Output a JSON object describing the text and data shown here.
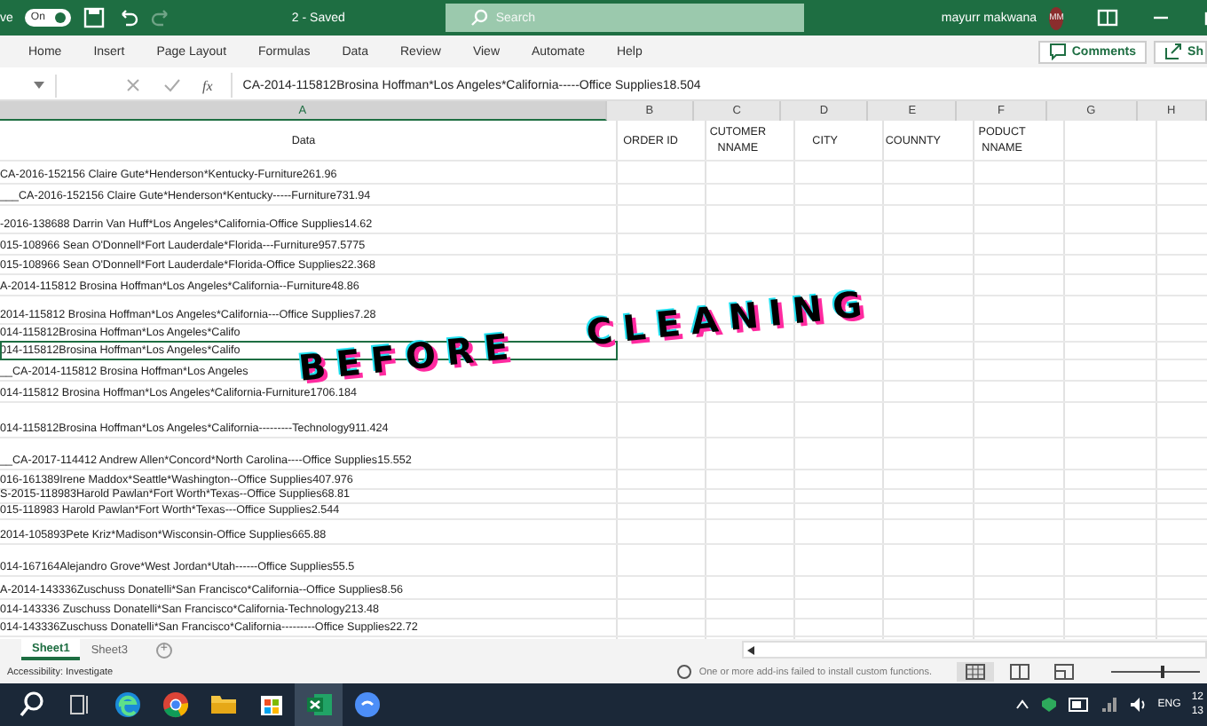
{
  "title_bar": {
    "autosave_label": "ve",
    "autosave_toggle": {
      "label": "On",
      "on": true
    },
    "doc_status": "2 - Saved",
    "search": {
      "placeholder": "Search"
    },
    "user_name": "mayurr makwana",
    "user_initials": "MM"
  },
  "ribbon_tabs": [
    {
      "label": "Home",
      "selected": false
    },
    {
      "label": "Insert",
      "selected": false
    },
    {
      "label": "Page Layout",
      "selected": false
    },
    {
      "label": "Formulas",
      "selected": false
    },
    {
      "label": "Data",
      "selected": false
    },
    {
      "label": "Review",
      "selected": false
    },
    {
      "label": "View",
      "selected": false
    },
    {
      "label": "Automate",
      "selected": false
    },
    {
      "label": "Help",
      "selected": false
    }
  ],
  "ribbon_buttons": {
    "comments": "Comments",
    "share": "Sh"
  },
  "formula_bar": {
    "fx": "fx",
    "value": "CA-2014-115812Brosina Hoffman*Los Angeles*California-----Office Supplies18.504"
  },
  "columns": [
    {
      "label": "A",
      "selected": true
    },
    {
      "label": "B",
      "selected": false
    },
    {
      "label": "C",
      "selected": false
    },
    {
      "label": "D",
      "selected": false
    },
    {
      "label": "E",
      "selected": false
    },
    {
      "label": "F",
      "selected": false
    },
    {
      "label": "G",
      "selected": false
    },
    {
      "label": "H",
      "selected": false
    }
  ],
  "header_row": [
    "Data",
    "ORDER ID",
    "CUTOMER NNAME",
    "CITY",
    "COUNNTY",
    "PODUCT NNAME"
  ],
  "rows": [
    {
      "text": "CA-2016-152156 Claire Gute*Henderson*Kentucky-Furniture261.96",
      "selected": false
    },
    {
      "text": "___CA-2016-152156 Claire Gute*Henderson*Kentucky-----Furniture731.94",
      "selected": false
    },
    {
      "text": "-2016-138688 Darrin Van Huff*Los Angeles*California-Office Supplies14.62",
      "selected": false
    },
    {
      "text": "015-108966 Sean O'Donnell*Fort Lauderdale*Florida---Furniture957.5775",
      "selected": false
    },
    {
      "text": "015-108966 Sean O'Donnell*Fort Lauderdale*Florida-Office Supplies22.368",
      "selected": false
    },
    {
      "text": "A-2014-115812 Brosina Hoffman*Los Angeles*California--Furniture48.86",
      "selected": false
    },
    {
      "text": "2014-115812 Brosina Hoffman*Los Angeles*California---Office Supplies7.28",
      "selected": false
    },
    {
      "text": "014-115812Brosina Hoffman*Los Angeles*Califo",
      "selected": false
    },
    {
      "text": "014-115812Brosina Hoffman*Los Angeles*Califo",
      "selected": true
    },
    {
      "text": "__CA-2014-115812 Brosina Hoffman*Los Angeles",
      "selected": false
    },
    {
      "text": "014-115812 Brosina Hoffman*Los Angeles*California-Furniture1706.184",
      "selected": false
    },
    {
      "text": "014-115812Brosina Hoffman*Los Angeles*California---------Technology911.424",
      "selected": false
    },
    {
      "text": "__CA-2017-114412 Andrew Allen*Concord*North Carolina----Office Supplies15.552",
      "selected": false
    },
    {
      "text": "016-161389Irene Maddox*Seattle*Washington--Office Supplies407.976",
      "selected": false
    },
    {
      "text": "S-2015-118983Harold Pawlan*Fort Worth*Texas--Office Supplies68.81",
      "selected": false
    },
    {
      "text": "015-118983 Harold Pawlan*Fort Worth*Texas---Office Supplies2.544",
      "selected": false
    },
    {
      "text": "2014-105893Pete Kriz*Madison*Wisconsin-Office Supplies665.88",
      "selected": false
    },
    {
      "text": "014-167164Alejandro Grove*West Jordan*Utah------Office Supplies55.5",
      "selected": false
    },
    {
      "text": "A-2014-143336Zuschuss Donatelli*San Francisco*California--Office Supplies8.56",
      "selected": false
    },
    {
      "text": "014-143336 Zuschuss Donatelli*San Francisco*California-Technology213.48",
      "selected": false
    },
    {
      "text": "014-143336Zuschuss Donatelli*San Francisco*California---------Office Supplies22.72",
      "selected": false
    }
  ],
  "overlay_caption_words": [
    "BEFORE",
    "CLEANING"
  ],
  "sheet_tabs": [
    {
      "label": "Sheet1",
      "selected": true
    },
    {
      "label": "Sheet3",
      "selected": false
    }
  ],
  "add_sheet": "+",
  "status_bar": {
    "accessibility": "Accessibility: Investigate",
    "message": "One or more add-ins failed to install custom functions.",
    "zoom_slider": {
      "level": 0.55
    }
  },
  "taskbar": {
    "language": "ENG",
    "clock": [
      "12",
      "13"
    ]
  }
}
